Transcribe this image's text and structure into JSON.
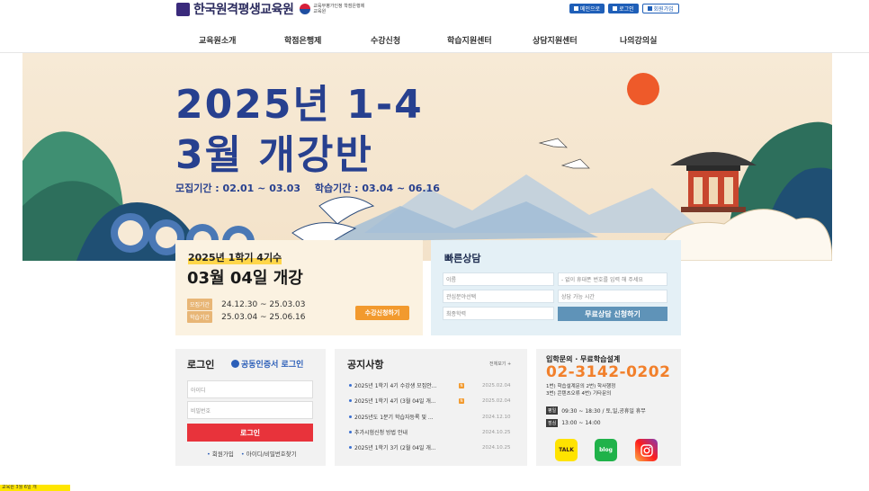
{
  "header": {
    "logo_text": "한국원격평생교육원",
    "logo_sub": "교육부평가인정 학점은행제교육원",
    "links": [
      {
        "label": "메인으로",
        "icon": "home-icon"
      },
      {
        "label": "로그인",
        "icon": "lock-icon"
      },
      {
        "label": "회원가입",
        "icon": "user-icon"
      }
    ]
  },
  "nav": {
    "items": [
      "교육원소개",
      "학점은행제",
      "수강신청",
      "학습지원센터",
      "상담지원센터",
      "나의강의실"
    ]
  },
  "banner": {
    "title_line1": "2025년 1-4",
    "title_line2": "3월 개강반",
    "recruit_period": "모집기간 : 02.01 ~ 03.03",
    "study_period": "학습기간 : 03.04 ~ 06.16"
  },
  "course": {
    "tag": "2025년 1학기 4기수",
    "date": "03월 04일 개강",
    "recruit_label": "모집기간",
    "recruit_range": "24.12.30 ~ 25.03.03",
    "study_label": "학습기간",
    "study_range": "25.03.04 ~ 25.06.16",
    "apply_button": "수강신청하기"
  },
  "quick": {
    "title": "빠른상담",
    "name_placeholder": "이름",
    "phone_placeholder": "- 없이 휴대폰 번호를 입력 해 주세요",
    "interest_placeholder": "관심분야선택",
    "time_placeholder": "상담 가능 시간",
    "edu_placeholder": "최종학력",
    "submit_button": "무료상담 신청하기"
  },
  "login": {
    "title": "로그인",
    "cert_link": "공동인증서 로그인",
    "id_placeholder": "아이디",
    "pw_placeholder": "비밀번호",
    "button": "로그인",
    "signup_link": "회원가입",
    "find_link": "아이디/비밀번호찾기"
  },
  "notice": {
    "title": "공지사항",
    "more": "전체보기 +",
    "items": [
      {
        "text": "2025년 1학기 4기 수강생 모집안...",
        "date": "2025.02.04",
        "new": true
      },
      {
        "text": "2025년 1학기 4기 (3월 04일 개...",
        "date": "2025.02.04",
        "new": true
      },
      {
        "text": "2025년도 1분기 학습자등록 및 ...",
        "date": "2024.12.10",
        "new": false
      },
      {
        "text": "추가시험신청 방법 안내",
        "date": "2024.10.25",
        "new": false
      },
      {
        "text": "2025년 1학기 3기 (2월 04일 개...",
        "date": "2024.10.25",
        "new": false
      }
    ],
    "new_badge": "N"
  },
  "inquiry": {
    "title": "입학문의 · 무료학습설계",
    "phone": "02-3142-0202",
    "line1": "1번) 학습설계문의   2번) 학사행정",
    "line2": "3번) 콘텐츠오류      4번) 기타문의",
    "weekday_label": "평일",
    "weekday_hours": "09:30 ~ 18:30 / 토,일,공휴일 휴무",
    "lunch_label": "점심",
    "lunch_hours": "13:00 ~ 14:00",
    "sns": [
      {
        "label": "TALK",
        "icon": "kakaotalk-icon"
      },
      {
        "label": "blog",
        "icon": "blog-icon"
      },
      {
        "label": "",
        "icon": "instagram-icon"
      }
    ]
  },
  "bottom_tab": "교육원 3월 6일 개"
}
